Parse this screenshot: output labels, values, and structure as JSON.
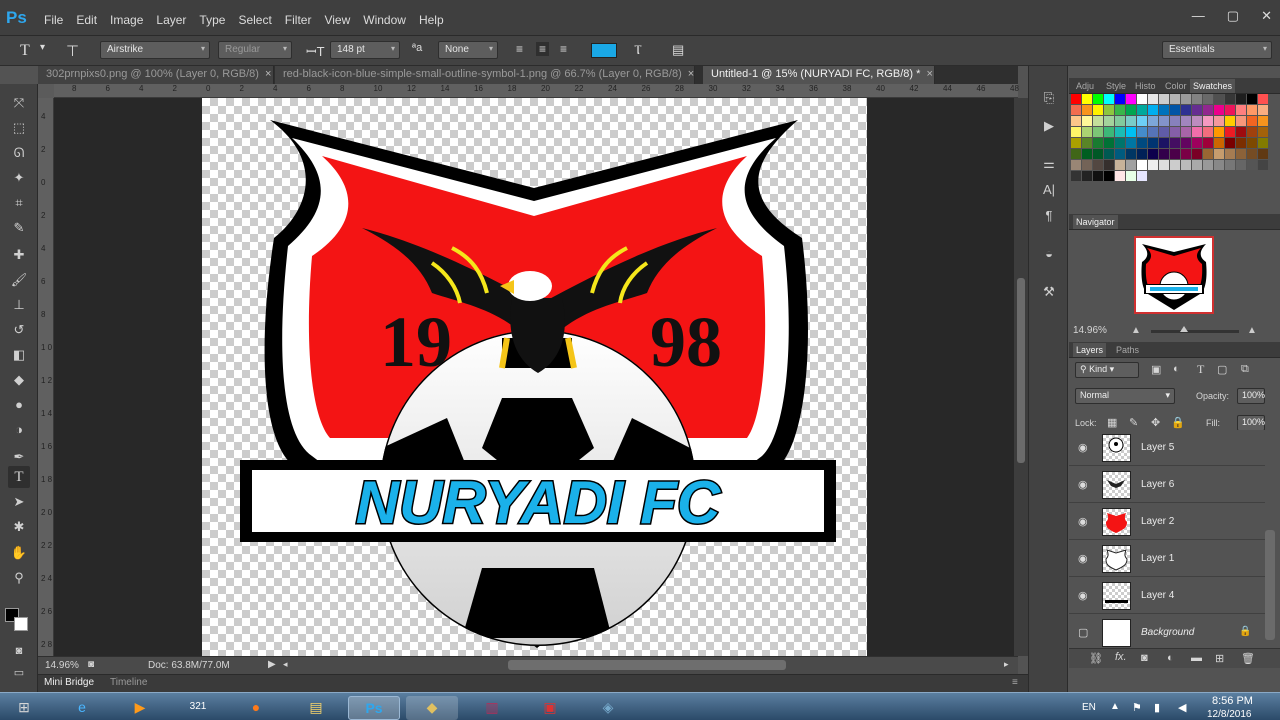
{
  "app": {
    "logo": "Ps",
    "menu": [
      "File",
      "Edit",
      "Image",
      "Layer",
      "Type",
      "Select",
      "Filter",
      "View",
      "Window",
      "Help"
    ],
    "window_controls": [
      "—",
      "▢",
      "✕"
    ]
  },
  "options": {
    "font_family": "Airstrike",
    "font_style": "Regular",
    "font_size": "148 pt",
    "anti_alias": "None",
    "text_color": "#1aa8e6",
    "workspace": "Essentials"
  },
  "tabs": [
    {
      "label": "302prnpixs0.png @ 100% (Layer 0, RGB/8)",
      "close": "×"
    },
    {
      "label": "red-black-icon-blue-simple-small-outline-symbol-1.png @ 66.7% (Layer 0, RGB/8)",
      "close": "×"
    },
    {
      "label": "Untitled-1 @ 15% (NURYADI FC, RGB/8) *",
      "close": "×"
    }
  ],
  "ruler_h": [
    "8",
    "6",
    "4",
    "2",
    "0",
    "2",
    "4",
    "6",
    "8",
    "10",
    "12",
    "14",
    "16",
    "18",
    "20",
    "22",
    "24",
    "26",
    "28",
    "30",
    "32",
    "34",
    "36",
    "38",
    "40",
    "42",
    "44",
    "46",
    "48"
  ],
  "ruler_v": [
    "4",
    "2",
    "0",
    "2",
    "4",
    "6",
    "8",
    "1 0",
    "1 2",
    "1 4",
    "1 6",
    "1 8",
    "2 0",
    "2 2",
    "2 4",
    "2 6",
    "2 8",
    "3 0"
  ],
  "artwork": {
    "team_name": "NURYADI FC",
    "year_left": "19",
    "year_right": "98",
    "shield_red": "#f41414",
    "name_blue": "#1ab1ea"
  },
  "status": {
    "zoom": "14.96%",
    "doc": "Doc: 63.8M/77.0M"
  },
  "bottom_tabs": [
    "Mini Bridge",
    "Timeline"
  ],
  "panel_tabs_top": [
    "Adju",
    "Style",
    "Histo",
    "Color",
    "Swatches"
  ],
  "navigator": {
    "title": "Navigator",
    "zoom": "14.96%"
  },
  "layers": {
    "tabs": [
      "Layers",
      "Paths"
    ],
    "kind": "Kind",
    "blend": "Normal",
    "opacity_label": "Opacity:",
    "opacity": "100%",
    "lock_label": "Lock:",
    "fill_label": "Fill:",
    "fill": "100%",
    "rows": [
      {
        "name": "Layer 5",
        "visible": true,
        "kind": "ball"
      },
      {
        "name": "Layer 6",
        "visible": true,
        "kind": "eagle"
      },
      {
        "name": "Layer 2",
        "visible": true,
        "kind": "red"
      },
      {
        "name": "Layer 1",
        "visible": true,
        "kind": "outline"
      },
      {
        "name": "Layer 4",
        "visible": true,
        "kind": "line"
      },
      {
        "name": "Background",
        "visible": false,
        "kind": "white"
      }
    ]
  },
  "taskbar": {
    "lang": "EN",
    "time": "8:56 PM",
    "date": "12/8/2016"
  },
  "colors": {
    "accent": "#1aa8e6",
    "swatch_grid": [
      "#ff0000",
      "#ffff00",
      "#00ff00",
      "#00ffff",
      "#0000ff",
      "#ff00ff",
      "#ffffff",
      "#e6e6e6",
      "#cdcdcd",
      "#b4b4b4",
      "#9b9b9b",
      "#828282",
      "#696969",
      "#505050",
      "#373737",
      "#1e1e1e",
      "#000000",
      "#ff5050",
      "#f26c4f",
      "#f7941d",
      "#fff200",
      "#8dc63f",
      "#39b54a",
      "#00a651",
      "#00a99d",
      "#00aeef",
      "#0072bc",
      "#0054a6",
      "#2e3192",
      "#662d91",
      "#92278f",
      "#ec008c",
      "#ed145b",
      "#ff7f7f",
      "#ff9966",
      "#f9ad81",
      "#fdc68a",
      "#fff799",
      "#c4df9b",
      "#a3d39c",
      "#82ca9c",
      "#7accc8",
      "#6dcff6",
      "#7da7d9",
      "#8393ca",
      "#8781bd",
      "#a186be",
      "#bd8cbf",
      "#f49ac1",
      "#f5989d",
      "#ffcc00",
      "#f7977a",
      "#f26522",
      "#f7941d",
      "#fff568",
      "#acd372",
      "#7cc576",
      "#3cb878",
      "#1cbbb4",
      "#00bff3",
      "#448ccb",
      "#5674b9",
      "#605ca8",
      "#855fa8",
      "#a864a8",
      "#f06eaa",
      "#f26d7d",
      "#ff9900",
      "#ed1c24",
      "#9e0b0f",
      "#a0410d",
      "#a3620a",
      "#aba000",
      "#598527",
      "#197b30",
      "#007236",
      "#00746b",
      "#0076a3",
      "#004a80",
      "#003471",
      "#1b1464",
      "#440e62",
      "#630460",
      "#9e005d",
      "#9e0039",
      "#cc6600",
      "#790000",
      "#7b2e00",
      "#7d4900",
      "#827b00",
      "#406618",
      "#005e20",
      "#005826",
      "#005952",
      "#005b7f",
      "#003663",
      "#002157",
      "#0d004c",
      "#32004b",
      "#4b0049",
      "#7b0046",
      "#7a0026",
      "#996633",
      "#c69c6d",
      "#a67c52",
      "#8c6239",
      "#754c24",
      "#603913",
      "#998675",
      "#736357",
      "#534741",
      "#362f2d",
      "#c7b299",
      "#a0a0a0",
      "#ffffff",
      "#eeeeee",
      "#dddddd",
      "#cccccc",
      "#bbbbbb",
      "#aaaaaa",
      "#999999",
      "#888888",
      "#777777",
      "#666666",
      "#555555",
      "#444444",
      "#333333",
      "#222222",
      "#111111",
      "#000000",
      "#ffe6e6",
      "#e6ffe6",
      "#e6e6ff"
    ]
  }
}
